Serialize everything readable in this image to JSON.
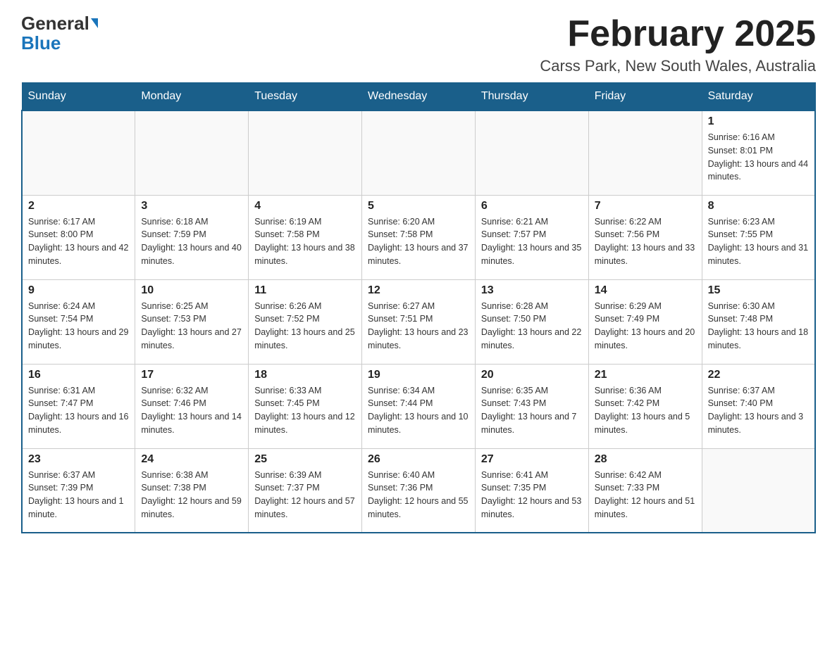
{
  "logo": {
    "part1": "General",
    "part2": "Blue"
  },
  "title": "February 2025",
  "subtitle": "Carss Park, New South Wales, Australia",
  "weekdays": [
    "Sunday",
    "Monday",
    "Tuesday",
    "Wednesday",
    "Thursday",
    "Friday",
    "Saturday"
  ],
  "weeks": [
    [
      {
        "day": "",
        "info": ""
      },
      {
        "day": "",
        "info": ""
      },
      {
        "day": "",
        "info": ""
      },
      {
        "day": "",
        "info": ""
      },
      {
        "day": "",
        "info": ""
      },
      {
        "day": "",
        "info": ""
      },
      {
        "day": "1",
        "info": "Sunrise: 6:16 AM\nSunset: 8:01 PM\nDaylight: 13 hours and 44 minutes."
      }
    ],
    [
      {
        "day": "2",
        "info": "Sunrise: 6:17 AM\nSunset: 8:00 PM\nDaylight: 13 hours and 42 minutes."
      },
      {
        "day": "3",
        "info": "Sunrise: 6:18 AM\nSunset: 7:59 PM\nDaylight: 13 hours and 40 minutes."
      },
      {
        "day": "4",
        "info": "Sunrise: 6:19 AM\nSunset: 7:58 PM\nDaylight: 13 hours and 38 minutes."
      },
      {
        "day": "5",
        "info": "Sunrise: 6:20 AM\nSunset: 7:58 PM\nDaylight: 13 hours and 37 minutes."
      },
      {
        "day": "6",
        "info": "Sunrise: 6:21 AM\nSunset: 7:57 PM\nDaylight: 13 hours and 35 minutes."
      },
      {
        "day": "7",
        "info": "Sunrise: 6:22 AM\nSunset: 7:56 PM\nDaylight: 13 hours and 33 minutes."
      },
      {
        "day": "8",
        "info": "Sunrise: 6:23 AM\nSunset: 7:55 PM\nDaylight: 13 hours and 31 minutes."
      }
    ],
    [
      {
        "day": "9",
        "info": "Sunrise: 6:24 AM\nSunset: 7:54 PM\nDaylight: 13 hours and 29 minutes."
      },
      {
        "day": "10",
        "info": "Sunrise: 6:25 AM\nSunset: 7:53 PM\nDaylight: 13 hours and 27 minutes."
      },
      {
        "day": "11",
        "info": "Sunrise: 6:26 AM\nSunset: 7:52 PM\nDaylight: 13 hours and 25 minutes."
      },
      {
        "day": "12",
        "info": "Sunrise: 6:27 AM\nSunset: 7:51 PM\nDaylight: 13 hours and 23 minutes."
      },
      {
        "day": "13",
        "info": "Sunrise: 6:28 AM\nSunset: 7:50 PM\nDaylight: 13 hours and 22 minutes."
      },
      {
        "day": "14",
        "info": "Sunrise: 6:29 AM\nSunset: 7:49 PM\nDaylight: 13 hours and 20 minutes."
      },
      {
        "day": "15",
        "info": "Sunrise: 6:30 AM\nSunset: 7:48 PM\nDaylight: 13 hours and 18 minutes."
      }
    ],
    [
      {
        "day": "16",
        "info": "Sunrise: 6:31 AM\nSunset: 7:47 PM\nDaylight: 13 hours and 16 minutes."
      },
      {
        "day": "17",
        "info": "Sunrise: 6:32 AM\nSunset: 7:46 PM\nDaylight: 13 hours and 14 minutes."
      },
      {
        "day": "18",
        "info": "Sunrise: 6:33 AM\nSunset: 7:45 PM\nDaylight: 13 hours and 12 minutes."
      },
      {
        "day": "19",
        "info": "Sunrise: 6:34 AM\nSunset: 7:44 PM\nDaylight: 13 hours and 10 minutes."
      },
      {
        "day": "20",
        "info": "Sunrise: 6:35 AM\nSunset: 7:43 PM\nDaylight: 13 hours and 7 minutes."
      },
      {
        "day": "21",
        "info": "Sunrise: 6:36 AM\nSunset: 7:42 PM\nDaylight: 13 hours and 5 minutes."
      },
      {
        "day": "22",
        "info": "Sunrise: 6:37 AM\nSunset: 7:40 PM\nDaylight: 13 hours and 3 minutes."
      }
    ],
    [
      {
        "day": "23",
        "info": "Sunrise: 6:37 AM\nSunset: 7:39 PM\nDaylight: 13 hours and 1 minute."
      },
      {
        "day": "24",
        "info": "Sunrise: 6:38 AM\nSunset: 7:38 PM\nDaylight: 12 hours and 59 minutes."
      },
      {
        "day": "25",
        "info": "Sunrise: 6:39 AM\nSunset: 7:37 PM\nDaylight: 12 hours and 57 minutes."
      },
      {
        "day": "26",
        "info": "Sunrise: 6:40 AM\nSunset: 7:36 PM\nDaylight: 12 hours and 55 minutes."
      },
      {
        "day": "27",
        "info": "Sunrise: 6:41 AM\nSunset: 7:35 PM\nDaylight: 12 hours and 53 minutes."
      },
      {
        "day": "28",
        "info": "Sunrise: 6:42 AM\nSunset: 7:33 PM\nDaylight: 12 hours and 51 minutes."
      },
      {
        "day": "",
        "info": ""
      }
    ]
  ]
}
